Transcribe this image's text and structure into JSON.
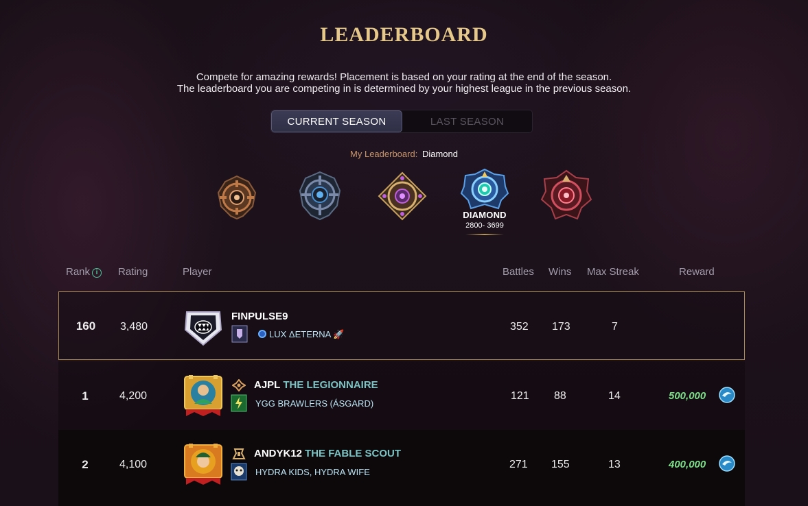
{
  "page": {
    "title": "LEADERBOARD",
    "subtitle_line1": "Compete for amazing rewards! Placement is based on your rating at the end of the season.",
    "subtitle_line2": "The leaderboard you are competing in is determined by your highest league in the previous season."
  },
  "season_tabs": {
    "current": "CURRENT SEASON",
    "last": "LAST SEASON",
    "selected": "current"
  },
  "my_leaderboard": {
    "label": "My Leaderboard:",
    "value": "Diamond"
  },
  "leagues": [
    {
      "name": "Bronze",
      "icon": "bronze-league-icon"
    },
    {
      "name": "Silver",
      "icon": "silver-league-icon"
    },
    {
      "name": "Gold",
      "icon": "gold-league-icon"
    },
    {
      "name": "DIAMOND",
      "range": "2800- 3699",
      "icon": "diamond-league-icon",
      "selected": true
    },
    {
      "name": "Champion",
      "icon": "champion-league-icon"
    }
  ],
  "columns": {
    "rank": "Rank",
    "rating": "Rating",
    "player": "Player",
    "battles": "Battles",
    "wins": "Wins",
    "max_streak": "Max Streak",
    "reward": "Reward"
  },
  "rows": [
    {
      "rank": "160",
      "rating": "3,480",
      "player": "FINPULSE9",
      "title": "",
      "guild": "LUX ΔETERNA",
      "battles": "352",
      "wins": "173",
      "streak": "7",
      "reward": "",
      "highlight": true
    },
    {
      "rank": "1",
      "rating": "4,200",
      "player": "AJPL",
      "title": "THE LEGIONNAIRE",
      "guild": "YGG BRAWLERS (ÁSGARD)",
      "battles": "121",
      "wins": "88",
      "streak": "14",
      "reward": "500,000"
    },
    {
      "rank": "2",
      "rating": "4,100",
      "player": "ANDYK12",
      "title": "THE FABLE SCOUT",
      "guild": "HYDRA KIDS, HYDRA WIFE",
      "battles": "271",
      "wins": "155",
      "streak": "13",
      "reward": "400,000"
    }
  ],
  "colors": {
    "title_gold": "#e6c98a",
    "highlight_border": "#a88952",
    "reward_green": "#7fe08b",
    "player_title_teal": "#7ec4c5"
  }
}
